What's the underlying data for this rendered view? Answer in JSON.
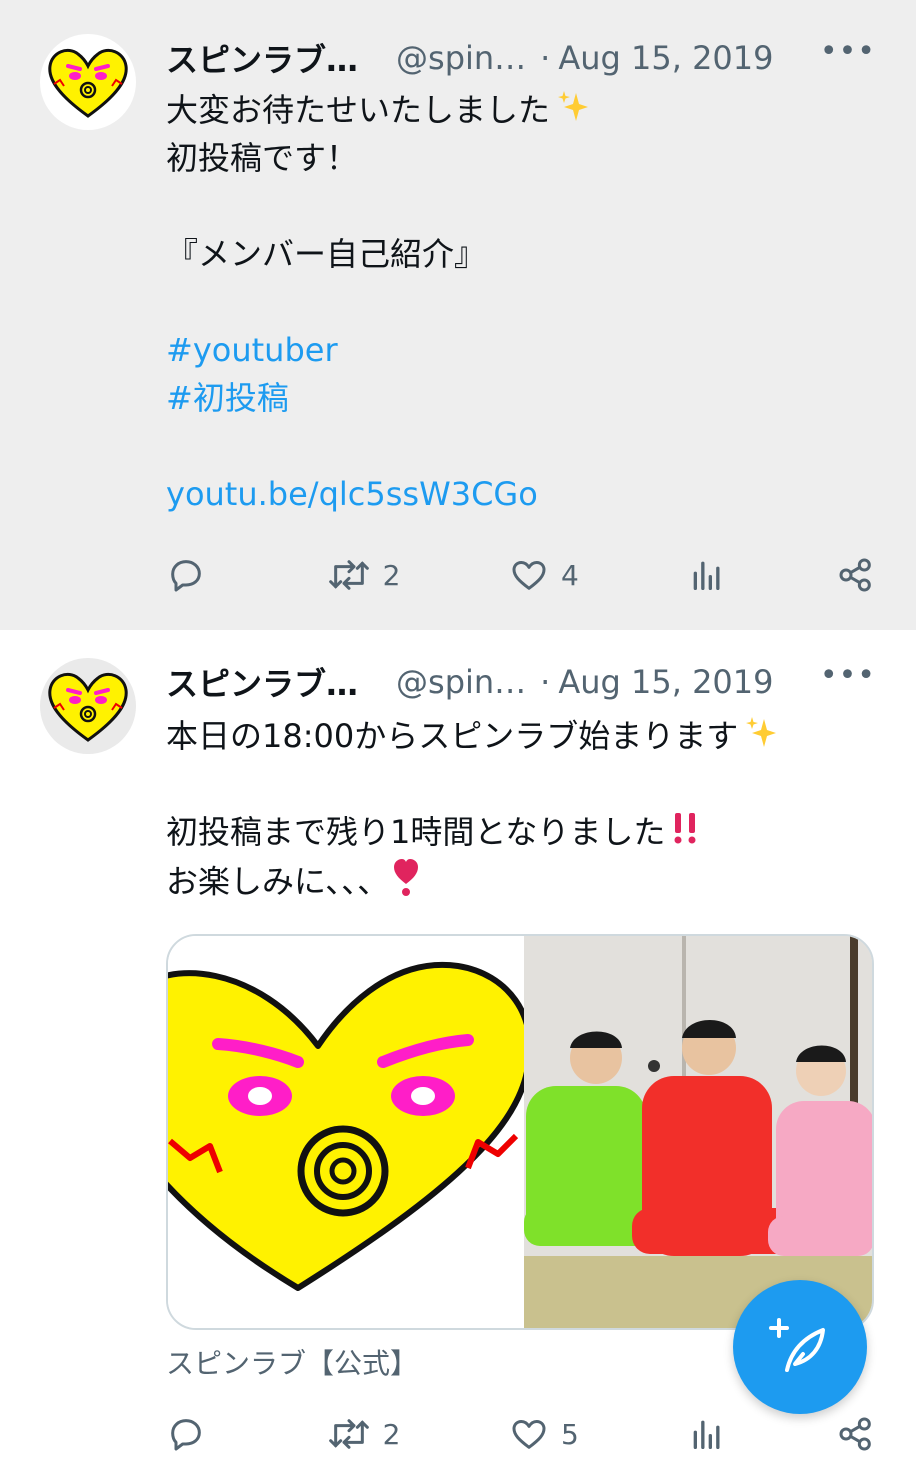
{
  "colors": {
    "accent": "#1d9bf0",
    "muted": "#536471",
    "heart_yellow": "#fff200",
    "brow_magenta": "#ff1ec8"
  },
  "tweets": [
    {
      "name": "スピンラブ…",
      "handle": "@spin…",
      "separator": "·",
      "date": "Aug 15, 2019",
      "lines": [
        "大変お待たせいたしました",
        "初投稿です！",
        "",
        "『メンバー自己紹介』",
        ""
      ],
      "hashtags": [
        "#youtuber",
        "#初投稿"
      ],
      "link": "youtu.be/qlc5ssW3CGo",
      "stats": {
        "reply": "",
        "retweet": "2",
        "like": "4"
      }
    },
    {
      "name": "スピンラブ…",
      "handle": "@spin…",
      "separator": "·",
      "date": "Aug 15, 2019",
      "lines": [
        "本日の18:00からスピンラブ始まります",
        "",
        "初投稿まで残り1時間となりました",
        "お楽しみに､､､ "
      ],
      "media_caption": "スピンラブ【公式】",
      "stats": {
        "reply": "",
        "retweet": "2",
        "like": "5"
      }
    }
  ],
  "icons": [
    "reply-icon",
    "retweet-icon",
    "like-icon",
    "views-icon",
    "share-icon",
    "more-icon",
    "compose-icon"
  ]
}
